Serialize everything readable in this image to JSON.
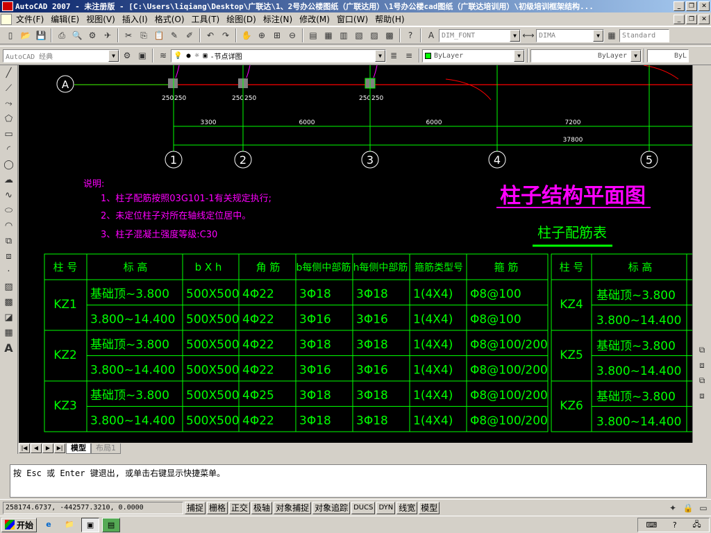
{
  "window": {
    "title": "AutoCAD 2007 - 未注册版 - [C:\\Users\\liqiang\\Desktop\\广联达\\1、2号办公楼图纸（广联达用）\\1号办公楼cad图纸（广联达培训用）\\初级培训框架结构..."
  },
  "menu": [
    "文件(F)",
    "编辑(E)",
    "视图(V)",
    "插入(I)",
    "格式(O)",
    "工具(T)",
    "绘图(D)",
    "标注(N)",
    "修改(M)",
    "窗口(W)",
    "帮助(H)"
  ],
  "toolbar": {
    "dimstyle": "DIM_FONT",
    "textstyle": "DIMA",
    "tablestyle": "Standard",
    "workspace": "AutoCAD 经典",
    "layer": "-节点详图",
    "color": "ByLayer",
    "linetype": "ByLayer",
    "lineweight": "ByL"
  },
  "drawing": {
    "axis_a": "A",
    "axis_numbers": [
      "1",
      "2",
      "3",
      "4",
      "5"
    ],
    "dims": [
      "3300",
      "6000",
      "6000",
      "7200"
    ],
    "total_dim": "37800",
    "col_dim": "250",
    "notes_title": "说明:",
    "notes": [
      "1、柱子配筋按照03G101-1有关规定执行;",
      "2、未定位柱子对所在轴线定位居中。",
      "3、柱子混凝土强度等级:C30"
    ],
    "title": "柱子结构平面图",
    "subtitle": "柱子配筋表"
  },
  "table_left": {
    "headers": [
      "柱 号",
      "标  高",
      "b X h",
      "角 筋",
      "b每侧中部筋",
      "h每侧中部筋",
      "箍筋类型号",
      "箍 筋"
    ],
    "rows": [
      {
        "id": "KZ1",
        "sub": [
          [
            "基础顶~3.800",
            "500X500",
            "4Φ22",
            "3Φ18",
            "3Φ18",
            "1(4X4)",
            "Φ8@100"
          ],
          [
            "3.800~14.400",
            "500X500",
            "4Φ22",
            "3Φ16",
            "3Φ16",
            "1(4X4)",
            "Φ8@100"
          ]
        ]
      },
      {
        "id": "KZ2",
        "sub": [
          [
            "基础顶~3.800",
            "500X500",
            "4Φ22",
            "3Φ18",
            "3Φ18",
            "1(4X4)",
            "Φ8@100/200"
          ],
          [
            "3.800~14.400",
            "500X500",
            "4Φ22",
            "3Φ16",
            "3Φ16",
            "1(4X4)",
            "Φ8@100/200"
          ]
        ]
      },
      {
        "id": "KZ3",
        "sub": [
          [
            "基础顶~3.800",
            "500X500",
            "4Φ25",
            "3Φ18",
            "3Φ18",
            "1(4X4)",
            "Φ8@100/200"
          ],
          [
            "3.800~14.400",
            "500X500",
            "4Φ22",
            "3Φ18",
            "3Φ18",
            "1(4X4)",
            "Φ8@100/200"
          ]
        ]
      }
    ]
  },
  "table_right": {
    "headers": [
      "柱 号",
      "标  高"
    ],
    "rows": [
      {
        "id": "KZ4",
        "sub": [
          "基础顶~3.800",
          "3.800~14.400"
        ]
      },
      {
        "id": "KZ5",
        "sub": [
          "基础顶~3.800",
          "3.800~14.400"
        ]
      },
      {
        "id": "KZ6",
        "sub": [
          "基础顶~3.800",
          "3.800~14.400"
        ]
      }
    ]
  },
  "tabs": {
    "model": "模型",
    "layout": "布局1"
  },
  "command_line": "按 Esc 或 Enter 键退出, 或单击右键显示快捷菜单。",
  "status": {
    "coords": "258174.6737, -442577.3210, 0.0000",
    "buttons": [
      "捕捉",
      "栅格",
      "正交",
      "极轴",
      "对象捕捉",
      "对象追踪",
      "DUCS",
      "DYN",
      "线宽",
      "模型"
    ]
  },
  "taskbar": {
    "start": "开始"
  },
  "colors": {
    "cad_bg": "#000000",
    "table_green": "#00ff00",
    "magenta": "#ff00ff",
    "axis_red": "#ff0000"
  }
}
